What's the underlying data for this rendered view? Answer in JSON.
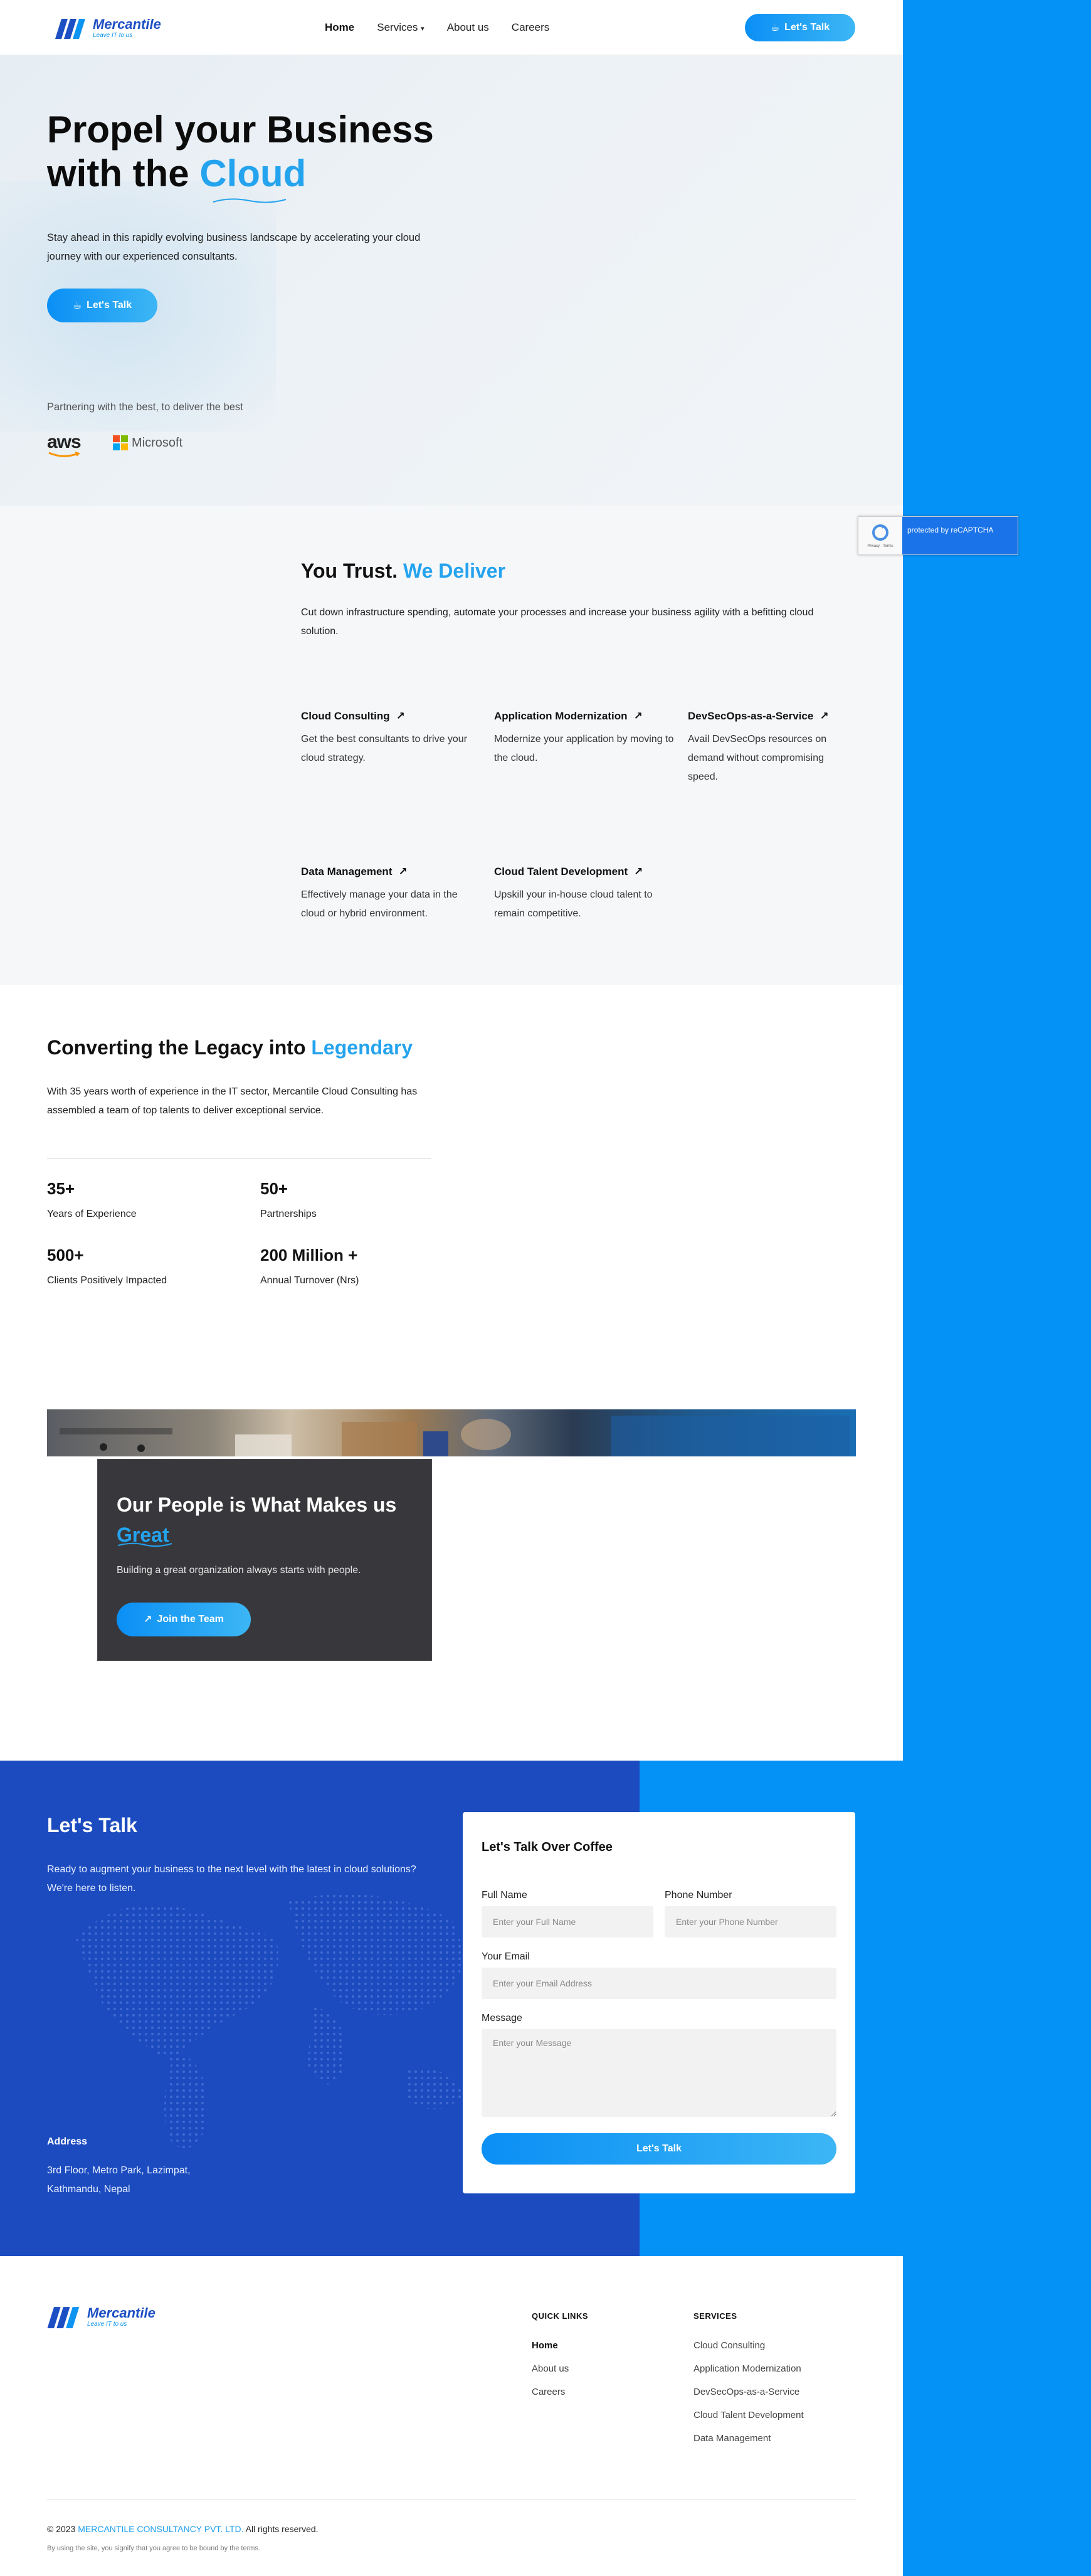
{
  "header": {
    "brand": "Mercantile",
    "tagline": "Leave IT to us",
    "nav": [
      "Home",
      "Services",
      "About us",
      "Careers"
    ],
    "cta": "Let's Talk"
  },
  "hero": {
    "title_line1": "Propel your Business",
    "title_line2_prefix": "with the ",
    "title_accent": "Cloud",
    "description": "Stay ahead in this rapidly evolving business landscape by accelerating your cloud journey with our experienced consultants.",
    "cta": "Let's Talk",
    "partners_text": "Partnering with the best, to deliver the best",
    "partner_aws": "aws",
    "partner_ms": "Microsoft"
  },
  "recaptcha": {
    "text": "protected by reCAPTCHA",
    "terms": "Privacy - Terms"
  },
  "trust": {
    "title_prefix": "You Trust. ",
    "title_accent": "We Deliver",
    "description": "Cut down infrastructure spending, automate your processes and increase your business agility with a befitting cloud solution.",
    "services": [
      {
        "title": "Cloud Consulting",
        "desc": "Get the best consultants to drive your cloud strategy."
      },
      {
        "title": "Application Modernization",
        "desc": "Modernize your application by moving to the cloud."
      },
      {
        "title": "DevSecOps-as-a-Service",
        "desc": "Avail DevSecOps resources on demand without compromising speed."
      },
      {
        "title": "Data Management",
        "desc": "Effectively manage your data in the cloud or hybrid environment."
      },
      {
        "title": "Cloud Talent Development",
        "desc": "Upskill your in-house cloud talent to remain competitive."
      }
    ]
  },
  "legacy": {
    "title_prefix": "Converting the Legacy into ",
    "title_accent": "Legendary",
    "description": "With 35 years worth of experience in the IT sector, Mercantile Cloud Consulting has assembled a team of top talents to deliver exceptional service.",
    "stats": [
      {
        "num": "35+",
        "label": "Years of Experience"
      },
      {
        "num": "50+",
        "label": "Partnerships"
      },
      {
        "num": "500+",
        "label": "Clients Positively Impacted"
      },
      {
        "num": "200 Million +",
        "label": "Annual Turnover (Nrs)"
      }
    ]
  },
  "people": {
    "title": "Our People is What Makes us",
    "title_accent": "Great",
    "desc": "Building a great organization always starts with people.",
    "cta": "Join the Team"
  },
  "contact": {
    "title": "Let's Talk",
    "description": "Ready to augment your business to the next level with the latest in cloud solutions? We're here to listen.",
    "address_title": "Address",
    "address": "3rd Floor, Metro Park, Lazimpat, Kathmandu, Nepal",
    "form": {
      "title": "Let's Talk Over Coffee",
      "name_label": "Full Name",
      "name_placeholder": "Enter your Full Name",
      "phone_label": "Phone Number",
      "phone_placeholder": "Enter your Phone Number",
      "email_label": "Your Email",
      "email_placeholder": "Enter your Email Address",
      "message_label": "Message",
      "message_placeholder": "Enter your Message",
      "submit": "Let's Talk"
    }
  },
  "footer": {
    "quick_links_title": "QUICK LINKS",
    "quick_links": [
      "Home",
      "About us",
      "Careers"
    ],
    "services_title": "SERVICES",
    "services": [
      "Cloud Consulting",
      "Application Modernization",
      "DevSecOps-as-a-Service",
      "Cloud Talent Development",
      "Data Management"
    ],
    "copyright_prefix": "© 2023 ",
    "company": "MERCANTILE CONSULTANCY PVT. LTD.",
    "copyright_suffix": " All rights reserved.",
    "terms": "By using the site, you signify that you agree to be bound by the terms."
  },
  "colors": {
    "accent": "#24a3ee",
    "brand_blue": "#1b4bbf",
    "bright_blue": "#0592f7"
  }
}
